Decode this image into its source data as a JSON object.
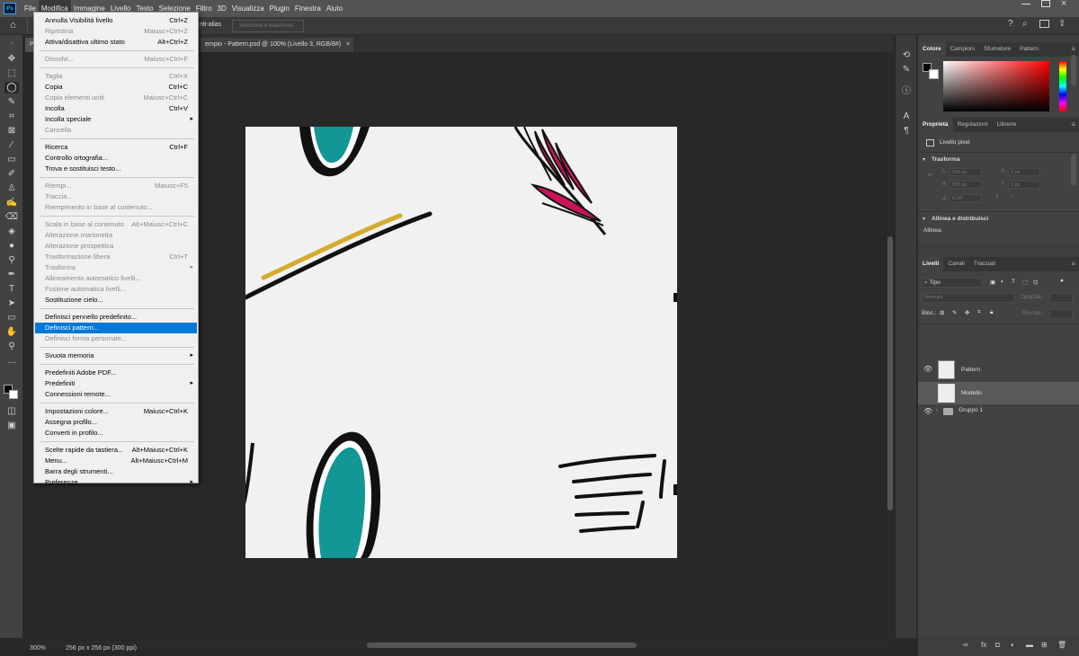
{
  "menubar": {
    "logo": "Ps",
    "items": [
      "File",
      "Modifica",
      "Immagine",
      "Livello",
      "Testo",
      "Selezione",
      "Filtro",
      "3D",
      "Visualizza",
      "Plugin",
      "Finestra",
      "Aiuto"
    ],
    "active_index": 1
  },
  "optionsbar": {
    "antialias": "nti-alias",
    "select_mask_button": "Seleziona e maschera..."
  },
  "document_tab": {
    "prefix": "P",
    "title": "empio - Pattern.psd @ 100% (Livello 3, RGB/8#)",
    "close": "×"
  },
  "dropdown": {
    "items": [
      {
        "label": "Annulla Visibilità livello",
        "shortcut": "Ctrl+Z",
        "state": "enabled"
      },
      {
        "label": "Ripristina",
        "shortcut": "Maiusc+Ctrl+Z",
        "state": "disabled"
      },
      {
        "label": "Attiva/disattiva ultimo stato",
        "shortcut": "Alt+Ctrl+Z",
        "state": "enabled"
      },
      {
        "sep": true
      },
      {
        "label": "Dissolvi...",
        "shortcut": "Maiusc+Ctrl+F",
        "state": "disabled"
      },
      {
        "sep": true
      },
      {
        "label": "Taglia",
        "shortcut": "Ctrl+X",
        "state": "disabled"
      },
      {
        "label": "Copia",
        "shortcut": "Ctrl+C",
        "state": "enabled"
      },
      {
        "label": "Copia elementi uniti",
        "shortcut": "Maiusc+Ctrl+C",
        "state": "disabled"
      },
      {
        "label": "Incolla",
        "shortcut": "Ctrl+V",
        "state": "enabled"
      },
      {
        "label": "Incolla speciale",
        "shortcut": "",
        "state": "enabled",
        "submenu": true
      },
      {
        "label": "Cancella",
        "shortcut": "",
        "state": "disabled"
      },
      {
        "sep": true
      },
      {
        "label": "Ricerca",
        "shortcut": "Ctrl+F",
        "state": "enabled"
      },
      {
        "label": "Controllo ortografia...",
        "shortcut": "",
        "state": "enabled"
      },
      {
        "label": "Trova e sostituisci testo...",
        "shortcut": "",
        "state": "enabled"
      },
      {
        "sep": true
      },
      {
        "label": "Riempi...",
        "shortcut": "Maiusc+F5",
        "state": "disabled"
      },
      {
        "label": "Traccia...",
        "shortcut": "",
        "state": "disabled"
      },
      {
        "label": "Riempimento in base al contenuto...",
        "shortcut": "",
        "state": "disabled"
      },
      {
        "sep": true
      },
      {
        "label": "Scala in base al contenuto",
        "shortcut": "Alt+Maiusc+Ctrl+C",
        "state": "disabled"
      },
      {
        "label": "Alterazione marionetta",
        "shortcut": "",
        "state": "disabled"
      },
      {
        "label": "Alterazione prospettica",
        "shortcut": "",
        "state": "disabled"
      },
      {
        "label": "Trasformazione libera",
        "shortcut": "Ctrl+T",
        "state": "disabled"
      },
      {
        "label": "Trasforma",
        "shortcut": "",
        "state": "disabled",
        "submenu": true
      },
      {
        "label": "Allineamento automatico livelli...",
        "shortcut": "",
        "state": "disabled"
      },
      {
        "label": "Fusione automatica livelli...",
        "shortcut": "",
        "state": "disabled"
      },
      {
        "label": "Sostituzione cielo...",
        "shortcut": "",
        "state": "enabled"
      },
      {
        "sep": true
      },
      {
        "label": "Definisci pennello predefinito...",
        "shortcut": "",
        "state": "enabled"
      },
      {
        "label": "Definisci pattern...",
        "shortcut": "",
        "state": "highlighted"
      },
      {
        "label": "Definisci forma personale...",
        "shortcut": "",
        "state": "disabled"
      },
      {
        "sep": true
      },
      {
        "label": "Svuota memoria",
        "shortcut": "",
        "state": "enabled",
        "submenu": true
      },
      {
        "sep": true
      },
      {
        "label": "Predefiniti Adobe PDF...",
        "shortcut": "",
        "state": "enabled"
      },
      {
        "label": "Predefiniti",
        "shortcut": "",
        "state": "enabled",
        "submenu": true
      },
      {
        "label": "Connessioni remote...",
        "shortcut": "",
        "state": "enabled"
      },
      {
        "sep": true
      },
      {
        "label": "Impostazioni colore...",
        "shortcut": "Maiusc+Ctrl+K",
        "state": "enabled"
      },
      {
        "label": "Assegna profilo...",
        "shortcut": "",
        "state": "enabled"
      },
      {
        "label": "Converti in profilo...",
        "shortcut": "",
        "state": "enabled"
      },
      {
        "sep": true
      },
      {
        "label": "Scelte rapide da tastiera...",
        "shortcut": "Alt+Maiusc+Ctrl+K",
        "state": "enabled"
      },
      {
        "label": "Menu...",
        "shortcut": "Alt+Maiusc+Ctrl+M",
        "state": "enabled"
      },
      {
        "label": "Barra degli strumenti...",
        "shortcut": "",
        "state": "enabled"
      },
      {
        "label": "Preferenze",
        "shortcut": "",
        "state": "enabled",
        "submenu": true
      }
    ]
  },
  "color_panel": {
    "tabs": [
      "Colore",
      "Campioni",
      "Sfumature",
      "Pattern"
    ],
    "active_tab": 0
  },
  "properties_panel": {
    "tabs": [
      "Proprietà",
      "Regolazioni",
      "Librerie"
    ],
    "active_tab": 0,
    "layer_type": "Livello pixel",
    "transform_section": "Trasforma",
    "L_label": "L",
    "L_value": "256 px",
    "A_label": "A",
    "A_value": "256 px",
    "X_label": "X",
    "X_value": "0 px",
    "Y_label": "Y",
    "Y_value": "0 px",
    "angle_value": "0,00°",
    "align_section": "Allinea e distribuisci",
    "align_label": "Allinea:"
  },
  "layers_panel": {
    "tabs": [
      "Livelli",
      "Canali",
      "Tracciati"
    ],
    "active_tab": 0,
    "filter_value": "Tipo",
    "blend_mode": "Normale",
    "opacity_label": "Opacità:",
    "lock_label": "Bloc.:",
    "fill_label": "Riempi.:",
    "layers": [
      {
        "name": "Pattern",
        "visible": true,
        "selected": false,
        "kind": "layer"
      },
      {
        "name": "Modello",
        "visible": false,
        "selected": true,
        "kind": "layer"
      },
      {
        "name": "Gruppo 1",
        "visible": true,
        "selected": false,
        "kind": "group"
      }
    ]
  },
  "status": {
    "zoom": "300%",
    "doc_info": "256 px x 256 px (300 ppi)"
  },
  "colors": {
    "teal": "#139696",
    "mustard": "#d4ab2c",
    "magenta": "#c8145a",
    "highlight": "#0078d7"
  }
}
